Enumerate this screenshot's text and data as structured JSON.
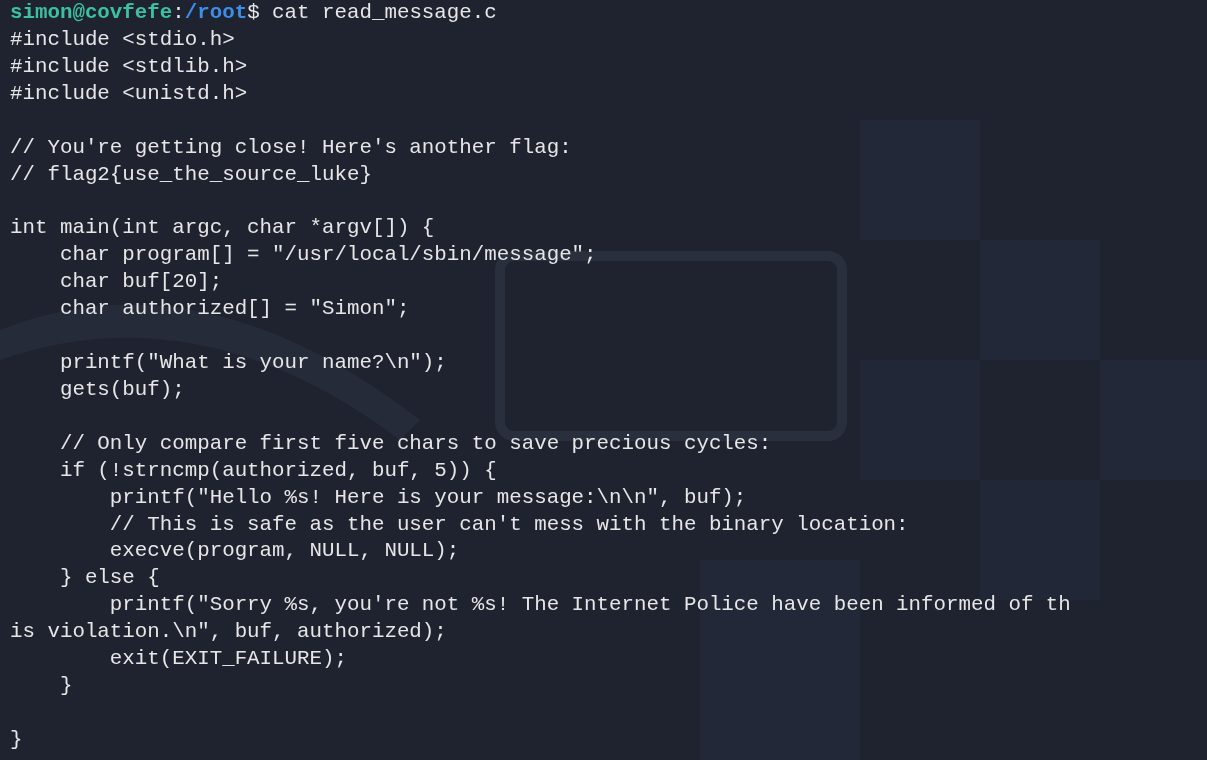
{
  "prompt": {
    "user_host": "simon@covfefe",
    "separator": ":",
    "path": "/root",
    "symbol": "$",
    "command": " cat read_message.c"
  },
  "lines": [
    {
      "kind": "text",
      "text": "#include <stdio.h>"
    },
    {
      "kind": "text",
      "text": "#include <stdlib.h>"
    },
    {
      "kind": "text",
      "text": "#include <unistd.h>"
    },
    {
      "kind": "blank"
    },
    {
      "kind": "text",
      "text": "// You're getting close! Here's another flag:"
    },
    {
      "kind": "text",
      "text": "// flag2{use_the_source_luke}"
    },
    {
      "kind": "blank"
    },
    {
      "kind": "text",
      "text": "int main(int argc, char *argv[]) {"
    },
    {
      "kind": "text",
      "text": "    char program[] = \"/usr/local/sbin/message\";"
    },
    {
      "kind": "text",
      "text": "    char buf[20];"
    },
    {
      "kind": "text",
      "text": "    char authorized[] = \"Simon\";"
    },
    {
      "kind": "blank"
    },
    {
      "kind": "text",
      "text": "    printf(\"What is your name?\\n\");"
    },
    {
      "kind": "text",
      "text": "    gets(buf);"
    },
    {
      "kind": "blank"
    },
    {
      "kind": "text",
      "text": "    // Only compare first five chars to save precious cycles:"
    },
    {
      "kind": "text",
      "text": "    if (!strncmp(authorized, buf, 5)) {"
    },
    {
      "kind": "text",
      "text": "        printf(\"Hello %s! Here is your message:\\n\\n\", buf);"
    },
    {
      "kind": "text",
      "text": "        // This is safe as the user can't mess with the binary location:"
    },
    {
      "kind": "text",
      "text": "        execve(program, NULL, NULL);"
    },
    {
      "kind": "text",
      "text": "    } else {"
    },
    {
      "kind": "text",
      "text": "        printf(\"Sorry %s, you're not %s! The Internet Police have been informed of th"
    },
    {
      "kind": "text",
      "text": "is violation.\\n\", buf, authorized);"
    },
    {
      "kind": "text",
      "text": "        exit(EXIT_FAILURE);"
    },
    {
      "kind": "text",
      "text": "    }"
    },
    {
      "kind": "blank"
    },
    {
      "kind": "text",
      "text": "}"
    }
  ]
}
